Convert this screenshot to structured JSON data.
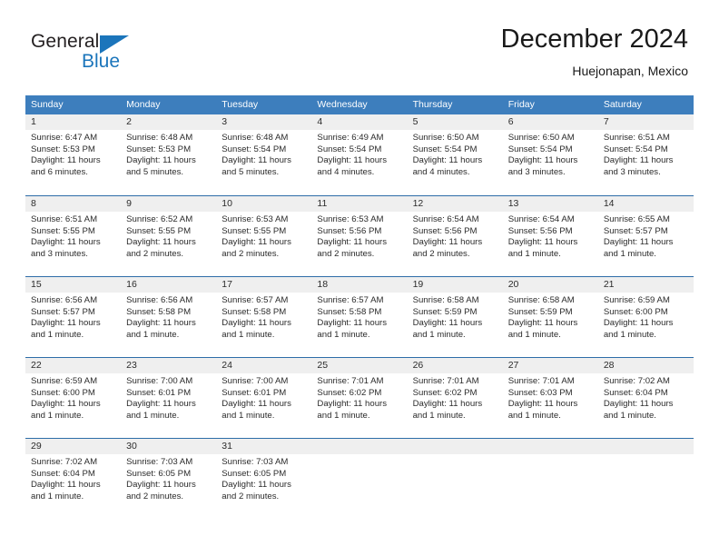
{
  "logo": {
    "word_one": "General",
    "word_two": "Blue",
    "triangle_color": "#1b75bb"
  },
  "header": {
    "title": "December 2024",
    "location": "Huejonapan, Mexico"
  },
  "theme": {
    "header_blue": "#3d7ebd",
    "row_line_blue": "#2e6da8",
    "day_band_gray": "#efefef"
  },
  "weekdays": [
    "Sunday",
    "Monday",
    "Tuesday",
    "Wednesday",
    "Thursday",
    "Friday",
    "Saturday"
  ],
  "weeks": [
    [
      {
        "day": "1",
        "sunrise": "Sunrise: 6:47 AM",
        "sunset": "Sunset: 5:53 PM",
        "daylight": "Daylight: 11 hours and 6 minutes."
      },
      {
        "day": "2",
        "sunrise": "Sunrise: 6:48 AM",
        "sunset": "Sunset: 5:53 PM",
        "daylight": "Daylight: 11 hours and 5 minutes."
      },
      {
        "day": "3",
        "sunrise": "Sunrise: 6:48 AM",
        "sunset": "Sunset: 5:54 PM",
        "daylight": "Daylight: 11 hours and 5 minutes."
      },
      {
        "day": "4",
        "sunrise": "Sunrise: 6:49 AM",
        "sunset": "Sunset: 5:54 PM",
        "daylight": "Daylight: 11 hours and 4 minutes."
      },
      {
        "day": "5",
        "sunrise": "Sunrise: 6:50 AM",
        "sunset": "Sunset: 5:54 PM",
        "daylight": "Daylight: 11 hours and 4 minutes."
      },
      {
        "day": "6",
        "sunrise": "Sunrise: 6:50 AM",
        "sunset": "Sunset: 5:54 PM",
        "daylight": "Daylight: 11 hours and 3 minutes."
      },
      {
        "day": "7",
        "sunrise": "Sunrise: 6:51 AM",
        "sunset": "Sunset: 5:54 PM",
        "daylight": "Daylight: 11 hours and 3 minutes."
      }
    ],
    [
      {
        "day": "8",
        "sunrise": "Sunrise: 6:51 AM",
        "sunset": "Sunset: 5:55 PM",
        "daylight": "Daylight: 11 hours and 3 minutes."
      },
      {
        "day": "9",
        "sunrise": "Sunrise: 6:52 AM",
        "sunset": "Sunset: 5:55 PM",
        "daylight": "Daylight: 11 hours and 2 minutes."
      },
      {
        "day": "10",
        "sunrise": "Sunrise: 6:53 AM",
        "sunset": "Sunset: 5:55 PM",
        "daylight": "Daylight: 11 hours and 2 minutes."
      },
      {
        "day": "11",
        "sunrise": "Sunrise: 6:53 AM",
        "sunset": "Sunset: 5:56 PM",
        "daylight": "Daylight: 11 hours and 2 minutes."
      },
      {
        "day": "12",
        "sunrise": "Sunrise: 6:54 AM",
        "sunset": "Sunset: 5:56 PM",
        "daylight": "Daylight: 11 hours and 2 minutes."
      },
      {
        "day": "13",
        "sunrise": "Sunrise: 6:54 AM",
        "sunset": "Sunset: 5:56 PM",
        "daylight": "Daylight: 11 hours and 1 minute."
      },
      {
        "day": "14",
        "sunrise": "Sunrise: 6:55 AM",
        "sunset": "Sunset: 5:57 PM",
        "daylight": "Daylight: 11 hours and 1 minute."
      }
    ],
    [
      {
        "day": "15",
        "sunrise": "Sunrise: 6:56 AM",
        "sunset": "Sunset: 5:57 PM",
        "daylight": "Daylight: 11 hours and 1 minute."
      },
      {
        "day": "16",
        "sunrise": "Sunrise: 6:56 AM",
        "sunset": "Sunset: 5:58 PM",
        "daylight": "Daylight: 11 hours and 1 minute."
      },
      {
        "day": "17",
        "sunrise": "Sunrise: 6:57 AM",
        "sunset": "Sunset: 5:58 PM",
        "daylight": "Daylight: 11 hours and 1 minute."
      },
      {
        "day": "18",
        "sunrise": "Sunrise: 6:57 AM",
        "sunset": "Sunset: 5:58 PM",
        "daylight": "Daylight: 11 hours and 1 minute."
      },
      {
        "day": "19",
        "sunrise": "Sunrise: 6:58 AM",
        "sunset": "Sunset: 5:59 PM",
        "daylight": "Daylight: 11 hours and 1 minute."
      },
      {
        "day": "20",
        "sunrise": "Sunrise: 6:58 AM",
        "sunset": "Sunset: 5:59 PM",
        "daylight": "Daylight: 11 hours and 1 minute."
      },
      {
        "day": "21",
        "sunrise": "Sunrise: 6:59 AM",
        "sunset": "Sunset: 6:00 PM",
        "daylight": "Daylight: 11 hours and 1 minute."
      }
    ],
    [
      {
        "day": "22",
        "sunrise": "Sunrise: 6:59 AM",
        "sunset": "Sunset: 6:00 PM",
        "daylight": "Daylight: 11 hours and 1 minute."
      },
      {
        "day": "23",
        "sunrise": "Sunrise: 7:00 AM",
        "sunset": "Sunset: 6:01 PM",
        "daylight": "Daylight: 11 hours and 1 minute."
      },
      {
        "day": "24",
        "sunrise": "Sunrise: 7:00 AM",
        "sunset": "Sunset: 6:01 PM",
        "daylight": "Daylight: 11 hours and 1 minute."
      },
      {
        "day": "25",
        "sunrise": "Sunrise: 7:01 AM",
        "sunset": "Sunset: 6:02 PM",
        "daylight": "Daylight: 11 hours and 1 minute."
      },
      {
        "day": "26",
        "sunrise": "Sunrise: 7:01 AM",
        "sunset": "Sunset: 6:02 PM",
        "daylight": "Daylight: 11 hours and 1 minute."
      },
      {
        "day": "27",
        "sunrise": "Sunrise: 7:01 AM",
        "sunset": "Sunset: 6:03 PM",
        "daylight": "Daylight: 11 hours and 1 minute."
      },
      {
        "day": "28",
        "sunrise": "Sunrise: 7:02 AM",
        "sunset": "Sunset: 6:04 PM",
        "daylight": "Daylight: 11 hours and 1 minute."
      }
    ],
    [
      {
        "day": "29",
        "sunrise": "Sunrise: 7:02 AM",
        "sunset": "Sunset: 6:04 PM",
        "daylight": "Daylight: 11 hours and 1 minute."
      },
      {
        "day": "30",
        "sunrise": "Sunrise: 7:03 AM",
        "sunset": "Sunset: 6:05 PM",
        "daylight": "Daylight: 11 hours and 2 minutes."
      },
      {
        "day": "31",
        "sunrise": "Sunrise: 7:03 AM",
        "sunset": "Sunset: 6:05 PM",
        "daylight": "Daylight: 11 hours and 2 minutes."
      },
      {
        "day": "",
        "sunrise": "",
        "sunset": "",
        "daylight": ""
      },
      {
        "day": "",
        "sunrise": "",
        "sunset": "",
        "daylight": ""
      },
      {
        "day": "",
        "sunrise": "",
        "sunset": "",
        "daylight": ""
      },
      {
        "day": "",
        "sunrise": "",
        "sunset": "",
        "daylight": ""
      }
    ]
  ]
}
